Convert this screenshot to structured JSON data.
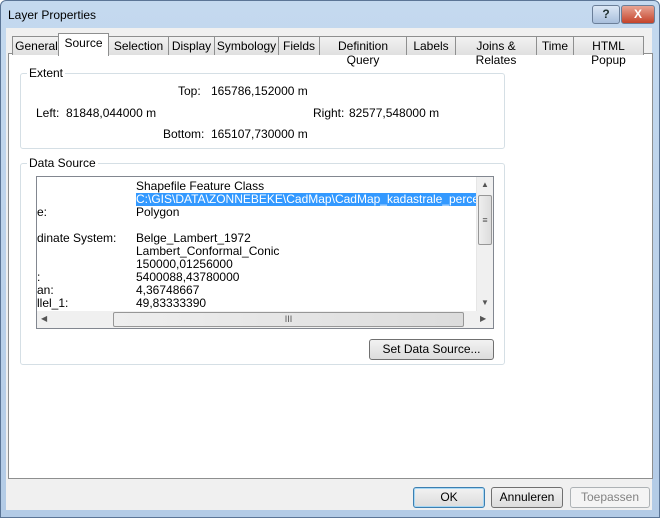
{
  "window": {
    "title": "Layer Properties",
    "help_label": "?",
    "close_label": "X"
  },
  "tabs": [
    "General",
    "Source",
    "Selection",
    "Display",
    "Symbology",
    "Fields",
    "Definition Query",
    "Labels",
    "Joins & Relates",
    "Time",
    "HTML Popup"
  ],
  "active_tab": "Source",
  "extent": {
    "label": "Extent",
    "top_label": "Top:",
    "top": "165786,152000 m",
    "left_label": "Left:",
    "left": "81848,044000 m",
    "right_label": "Right:",
    "right": "82577,548000 m",
    "bottom_label": "Bottom:",
    "bottom": "165107,730000 m"
  },
  "data_source": {
    "label": "Data Source",
    "rows": [
      {
        "key": "",
        "value": "Shapefile Feature Class"
      },
      {
        "key": "",
        "value": "C:\\GIS\\DATA\\ZONNEBEKE\\CadMap\\CadMap_kadastrale_percelen.shp",
        "selected": true
      },
      {
        "key": "e:",
        "value": "Polygon"
      },
      {
        "key": "",
        "value": ""
      },
      {
        "key": "dinate System:",
        "value": "Belge_Lambert_1972"
      },
      {
        "key": "",
        "value": "Lambert_Conformal_Conic"
      },
      {
        "key": "",
        "value": "150000,01256000"
      },
      {
        "key": ":",
        "value": "5400088,43780000"
      },
      {
        "key": "an:",
        "value": "4,36748667"
      },
      {
        "key": "llel_1:",
        "value": "49,83333390"
      }
    ],
    "set_button": "Set Data Source..."
  },
  "buttons": {
    "ok": "OK",
    "cancel": "Annuleren",
    "apply": "Toepassen"
  }
}
